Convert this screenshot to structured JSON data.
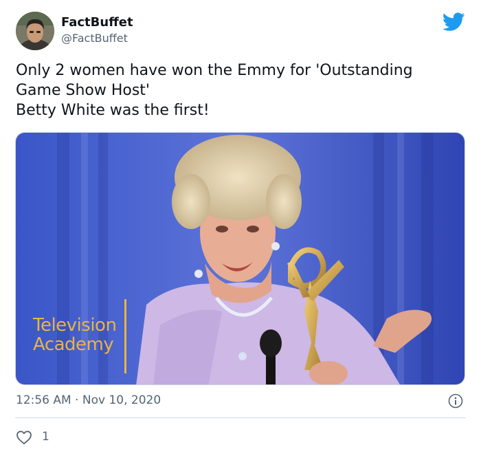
{
  "author": {
    "name": "FactBuffet",
    "handle": "@FactBuffet"
  },
  "tweet": {
    "lines": [
      "Only 2 women have won the Emmy for 'Outstanding",
      "Game Show Host'",
      "Betty White was the first!"
    ]
  },
  "media": {
    "watermark_line1": "Television",
    "watermark_line2": "Academy"
  },
  "meta": {
    "timestamp": "12:56 AM · Nov 10, 2020",
    "like_count": "1"
  },
  "icons": {
    "brand": "twitter-bird-icon",
    "info": "info-icon",
    "like": "heart-icon"
  },
  "colors": {
    "brand": "#1d9bf0",
    "text": "#0f1419",
    "secondary": "#536471",
    "watermark": "#e9b542"
  }
}
